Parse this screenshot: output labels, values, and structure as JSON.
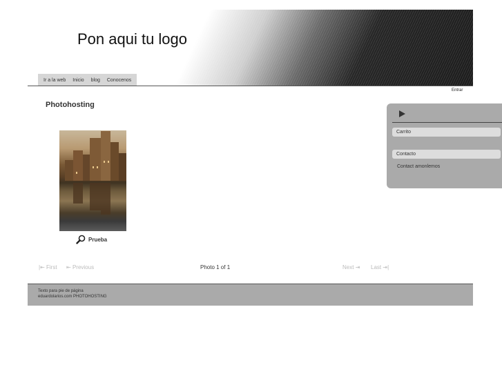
{
  "header": {
    "logo_text": "Pon aqui tu logo",
    "nav": [
      "Ir a la web",
      "Inicio",
      "blog",
      "Conocenos"
    ]
  },
  "login_label": "Entrar",
  "main": {
    "title": "Photohosting",
    "photo": {
      "caption": "Prueba"
    },
    "pager": {
      "first": "First",
      "previous": "Previous",
      "status": "Photo 1 of 1",
      "next": "Next",
      "last": "Last"
    }
  },
  "sidebar": {
    "cart_title": "Carrito",
    "contact_title": "Contacto",
    "contact_link": "Contact amonlemos"
  },
  "footer": {
    "line1": "Texto para pie de página",
    "line2": "eduardolarios.com PHOTOHOSTING"
  },
  "colors": {
    "accent": "#aaaaaa",
    "header_dark": "#1c1c1c",
    "footer_bg": "#aaaaaa"
  }
}
